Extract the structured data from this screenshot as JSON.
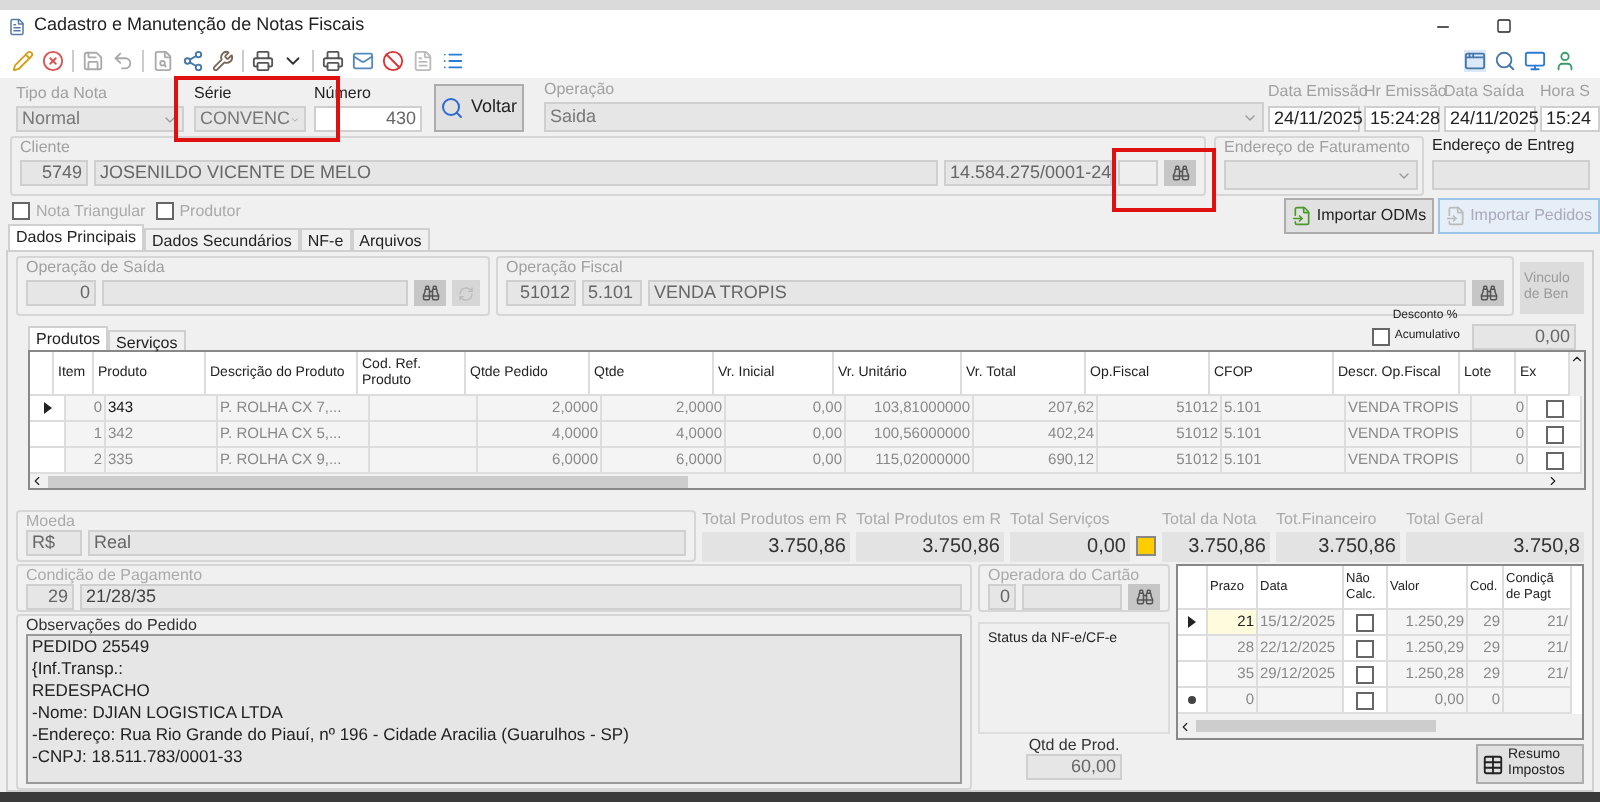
{
  "window": {
    "title": "Cadastro e Manutenção de Notas Fiscais"
  },
  "nota": {
    "tipo": {
      "label": "Tipo da Nota",
      "value": "Normal"
    },
    "serie": {
      "label": "Série",
      "value": "CONVENC"
    },
    "numero": {
      "label": "Número",
      "value": "430"
    },
    "voltar_button": "Voltar",
    "operacao": {
      "label": "Operação",
      "value": "Saida"
    },
    "datas": [
      {
        "label": "Data Emissão",
        "value": "24/11/2025"
      },
      {
        "label": "Hr Emissão",
        "value": "15:24:28"
      },
      {
        "label": "Data Saída",
        "value": "24/11/2025"
      },
      {
        "label": "Hora S",
        "value": "15:24"
      }
    ]
  },
  "cliente": {
    "label": "Cliente",
    "code": "5749",
    "name": "JOSENILDO VICENTE DE MELO",
    "document": "14.584.275/0001-24"
  },
  "endereco_faturamento": {
    "label": "Endereço de Faturamento"
  },
  "endereco_entrega": {
    "label": "Endereço de Entreg"
  },
  "options": [
    {
      "label": "Nota Triangular",
      "checked": false
    },
    {
      "label": "Produtor",
      "checked": false
    }
  ],
  "import_buttons": [
    {
      "label": "Importar ODMs",
      "disabled": false
    },
    {
      "label": "Importar Pedidos",
      "disabled": true
    }
  ],
  "tabs": [
    {
      "label": "Dados Principais",
      "selected": true
    },
    {
      "label": "Dados Secundários",
      "selected": false
    },
    {
      "label": "NF-e",
      "selected": false
    },
    {
      "label": "Arquivos",
      "selected": false
    }
  ],
  "operacao_saida": {
    "label": "Operação de Saída",
    "code": "0"
  },
  "operacao_fiscal": {
    "label": "Operação Fiscal",
    "code": "51012",
    "cfop": "5.101",
    "name": "VENDA TROPIS"
  },
  "vinculo_button": [
    "Vinculo",
    "de Ben"
  ],
  "desconto": {
    "label": "Desconto %",
    "option": {
      "label": "Acumulativo",
      "checked": false
    },
    "value": "0,00"
  },
  "item_tabs": [
    {
      "label": "Produtos",
      "selected": true
    },
    {
      "label": "Serviços",
      "selected": false
    }
  ],
  "items_table": {
    "columns": [
      "Item",
      "Produto",
      "Descrição do Produto",
      "Cod. Ref. Produto",
      "Qtde Pedido",
      "Qtde",
      "Vr. Inicial",
      "Vr. Unitário",
      "Vr. Total",
      "Op.Fiscal",
      "CFOP",
      "Descr. Op.Fiscal",
      "Lote",
      "Ex"
    ],
    "rows": [
      {
        "selected": true,
        "item": "0",
        "produto": "343",
        "descricao": "P. ROLHA CX 7,...",
        "qtde_pedido": "2,0000",
        "qtde": "2,0000",
        "vr_inicial": "0,00",
        "vr_unitario": "103,81000000",
        "vr_total": "207,62",
        "op_fiscal": "51012",
        "cfop": "5.101",
        "descr_op": "VENDA TROPIS",
        "lote": "0",
        "ex": false
      },
      {
        "selected": false,
        "item": "1",
        "produto": "342",
        "descricao": "P. ROLHA CX 5,...",
        "qtde_pedido": "4,0000",
        "qtde": "4,0000",
        "vr_inicial": "0,00",
        "vr_unitario": "100,56000000",
        "vr_total": "402,24",
        "op_fiscal": "51012",
        "cfop": "5.101",
        "descr_op": "VENDA TROPIS",
        "lote": "0",
        "ex": false
      },
      {
        "selected": false,
        "item": "2",
        "produto": "335",
        "descricao": "P. ROLHA CX 9,...",
        "qtde_pedido": "6,0000",
        "qtde": "6,0000",
        "vr_inicial": "0,00",
        "vr_unitario": "115,02000000",
        "vr_total": "690,12",
        "op_fiscal": "51012",
        "cfop": "5.101",
        "descr_op": "VENDA TROPIS",
        "lote": "0",
        "ex": false
      }
    ]
  },
  "moeda": {
    "label": "Moeda",
    "code": "R$",
    "name": "Real"
  },
  "totals": [
    {
      "kind": "plain",
      "label": "Total Produtos em R",
      "value": "3.750,86"
    },
    {
      "kind": "plain",
      "label": "Total Produtos em R",
      "value": "3.750,86"
    },
    {
      "kind": "plain",
      "label": "Total Serviços",
      "value": "0,00"
    },
    {
      "kind": "flagged",
      "label": "Total da Nota",
      "value": "3.750,86"
    },
    {
      "kind": "plain",
      "label": "Tot.Financeiro",
      "value": "3.750,86"
    },
    {
      "kind": "plain",
      "label": "Total Geral",
      "value": "3.750,8"
    }
  ],
  "condicao_pagamento": {
    "label": "Condição de Pagamento",
    "code": "29",
    "value": "21/28/35"
  },
  "operadora_cartao": {
    "label": "Operadora do Cartão",
    "code": "0"
  },
  "observacoes": {
    "label": "Observações do Pedido",
    "lines": [
      "PEDIDO 25549",
      "{Inf.Transp.:",
      "REDESPACHO",
      "-Nome: DJIAN LOGISTICA LTDA",
      "-Endereço: Rua Rio Grande do Piauí, nº 196 - Cidade Aracilia (Guarulhos - SP)",
      "-CNPJ: 18.511.783/0001-33"
    ]
  },
  "status_nfe": {
    "label": "Status da NF-e/CF-e"
  },
  "qtd_prod": {
    "label": "Qtd de Prod.",
    "value": "60,00"
  },
  "parcelas_table": {
    "columns": [
      "Prazo",
      "Data",
      "Não Calc.",
      "Valor",
      "Cod.",
      "Condiçã de Pagt"
    ],
    "rows": [
      {
        "kind": "entry",
        "selected": true,
        "prazo": "21",
        "data": "15/12/2025",
        "nao_calc": false,
        "valor": "1.250,29",
        "cod": "29",
        "condicao": "21/"
      },
      {
        "kind": "entry",
        "selected": false,
        "prazo": "28",
        "data": "22/12/2025",
        "nao_calc": false,
        "valor": "1.250,29",
        "cod": "29",
        "condicao": "21/"
      },
      {
        "kind": "entry",
        "selected": false,
        "prazo": "35",
        "data": "29/12/2025",
        "nao_calc": false,
        "valor": "1.250,28",
        "cod": "29",
        "condicao": "21/"
      },
      {
        "kind": "new",
        "selected": false,
        "prazo": "0",
        "nao_calc": false,
        "valor": "0,00",
        "cod": "0"
      }
    ]
  },
  "resumo_button": [
    "Resumo",
    "Impostos"
  ]
}
